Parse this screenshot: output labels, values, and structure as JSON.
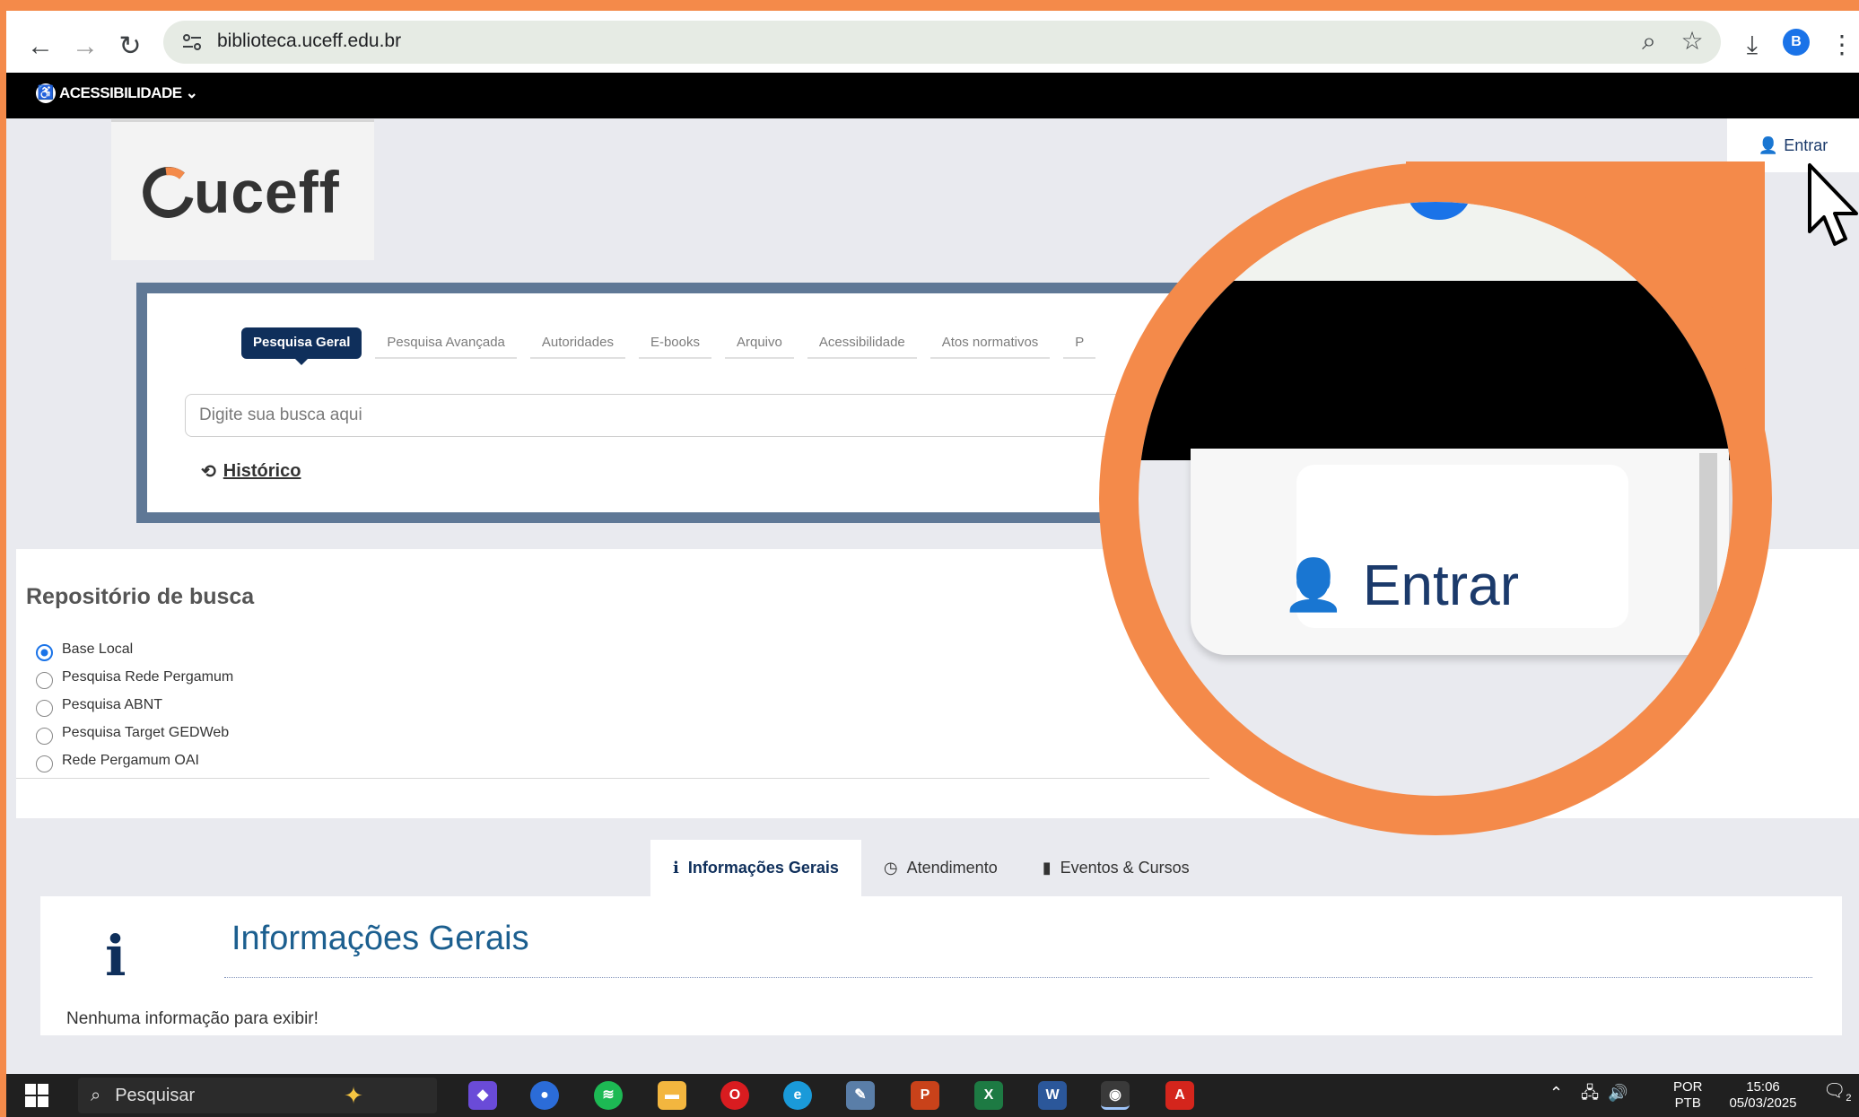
{
  "browser": {
    "url": "biblioteca.uceff.edu.br",
    "profile_initial": "B"
  },
  "accessibility": {
    "label": "ACESSIBILIDADE"
  },
  "login": {
    "label": "Entrar"
  },
  "logo": {
    "text": "uceff"
  },
  "search": {
    "tabs": [
      "Pesquisa Geral",
      "Pesquisa Avançada",
      "Autoridades",
      "E-books",
      "Arquivo",
      "Acessibilidade",
      "Atos normativos",
      "P"
    ],
    "placeholder": "Digite sua busca aqui",
    "history_label": "Histórico"
  },
  "repository": {
    "title": "Repositório de busca",
    "options": [
      "Base Local",
      "Pesquisa Rede Pergamum",
      "Pesquisa ABNT",
      "Pesquisa Target GEDWeb",
      "Rede Pergamum OAI"
    ],
    "selected": "Base Local"
  },
  "info": {
    "tabs": [
      "Informações Gerais",
      "Atendimento",
      "Eventos & Cursos"
    ],
    "title": "Informações Gerais",
    "empty_message": "Nenhuma informação para exibir!"
  },
  "magnifier": {
    "label": "Entrar"
  },
  "taskbar": {
    "search_label": "Pesquisar",
    "lang_top": "POR",
    "lang_bottom": "PTB",
    "time": "15:06",
    "date": "05/03/2025",
    "notif_count": "2"
  },
  "colors": {
    "accent": "#f48a4a",
    "navy": "#0f2f5b",
    "panel_border": "#5f7896"
  }
}
